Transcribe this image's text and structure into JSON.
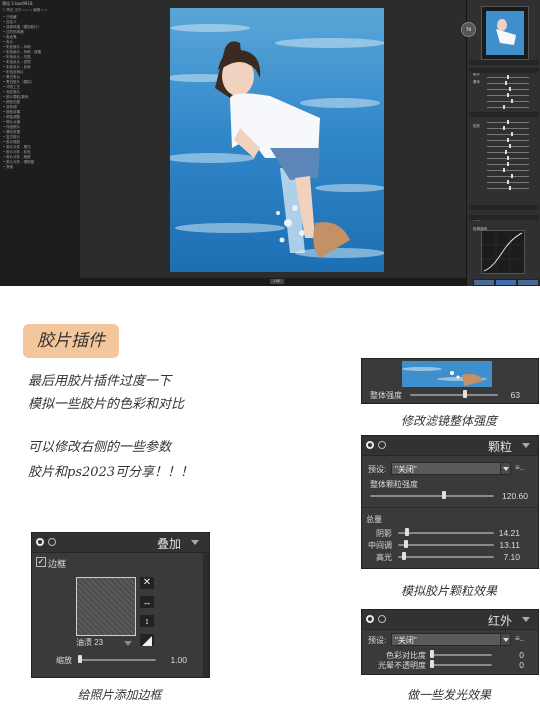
{
  "editor": {
    "left_panel": {
      "header": "预设 3 box9918",
      "tools": "▢ 预设  文件  ▫  ▫  ▫  编辑  ▫  ▫",
      "items": [
        "• 已收藏",
        "• 自定义",
        "• 选择风格（模拟胶片）",
        "• 过时的风格",
        "• 吸血鬼",
        "• 负片",
        "• 彩色胶片 - 印刷",
        "• 彩色胶片 - 印刷 - 遮罩",
        "• 彩色负片 - 扫描",
        "• 彩色负片 - 滤镜",
        "• 彩色负片 - 反转",
        "• 彩色反转片",
        "• 黑白负片",
        "• 黑白胶片（模拟）",
        "• 冲洗工艺",
        "• 泡在胶片",
        "• 胶片颗粒/数码",
        "• 颜色匹配",
        "• 双色调",
        "• 颜色效果",
        "• 颜色调整",
        "• 照片点缀",
        "• 传统照片",
        "• 漏光效果",
        "• 复古胶片",
        "• 胶片瑕疵",
        "• 胶片元件 - 黑白",
        "• 胶片元件 - 彩色",
        "• 胶片元件 - 暗房",
        "• 胶片元件 - 透明度",
        "• 其他"
      ]
    },
    "status_zoom": "100",
    "navigator_badge": "70",
    "right_panel": {
      "sections": [
        "胶片",
        "基本",
        "色彩",
        "颗粒",
        "色调曲线"
      ]
    }
  },
  "badge": "胶片插件",
  "paragraph_1": [
    "最后用胶片插件过度一下",
    "模拟一些胶片的色彩和对比"
  ],
  "paragraph_2": [
    "可以修改右侧的一些参数",
    "胶片和ps2023可分享！！！"
  ],
  "panel_strength": {
    "label": "整体强度",
    "value": "63",
    "value_fraction": 0.63,
    "caption": "修改滤镜整体强度"
  },
  "panel_grain": {
    "title": "颗粒",
    "preset_label": "预设:",
    "preset_value": "\"关闭\"",
    "overall_label": "整体颗粒强度",
    "overall_value": "120.60",
    "group_label": "总量",
    "rows": [
      {
        "label": "阴影",
        "value": "14.21",
        "fraction": 0.07
      },
      {
        "label": "中间调",
        "value": "13.11",
        "fraction": 0.065
      },
      {
        "label": "高光",
        "value": "7.10",
        "fraction": 0.04
      }
    ],
    "overall_fraction": 0.6,
    "caption": "模拟胶片颗粒效果"
  },
  "panel_overlay": {
    "title": "叠加",
    "border_label": "边框",
    "border_checked": true,
    "frame_name": "油渍 23",
    "scale_label": "缩放",
    "scale_value": "1.00",
    "scale_fraction": 0.02,
    "caption": "给照片添加边框"
  },
  "panel_infrared": {
    "title": "红外",
    "preset_label": "预设:",
    "preset_value": "\"关闭\"",
    "rows": [
      {
        "label": "色彩对比度",
        "value": "0",
        "fraction": 0.0
      },
      {
        "label": "光晕不透明度",
        "value": "0",
        "fraction": 0.0
      }
    ],
    "caption": "做一些发光效果"
  },
  "colors": {
    "badge_bg": "#f4c69b",
    "panel_bg": "#3a3a3a",
    "editor_bg": "#262626"
  }
}
